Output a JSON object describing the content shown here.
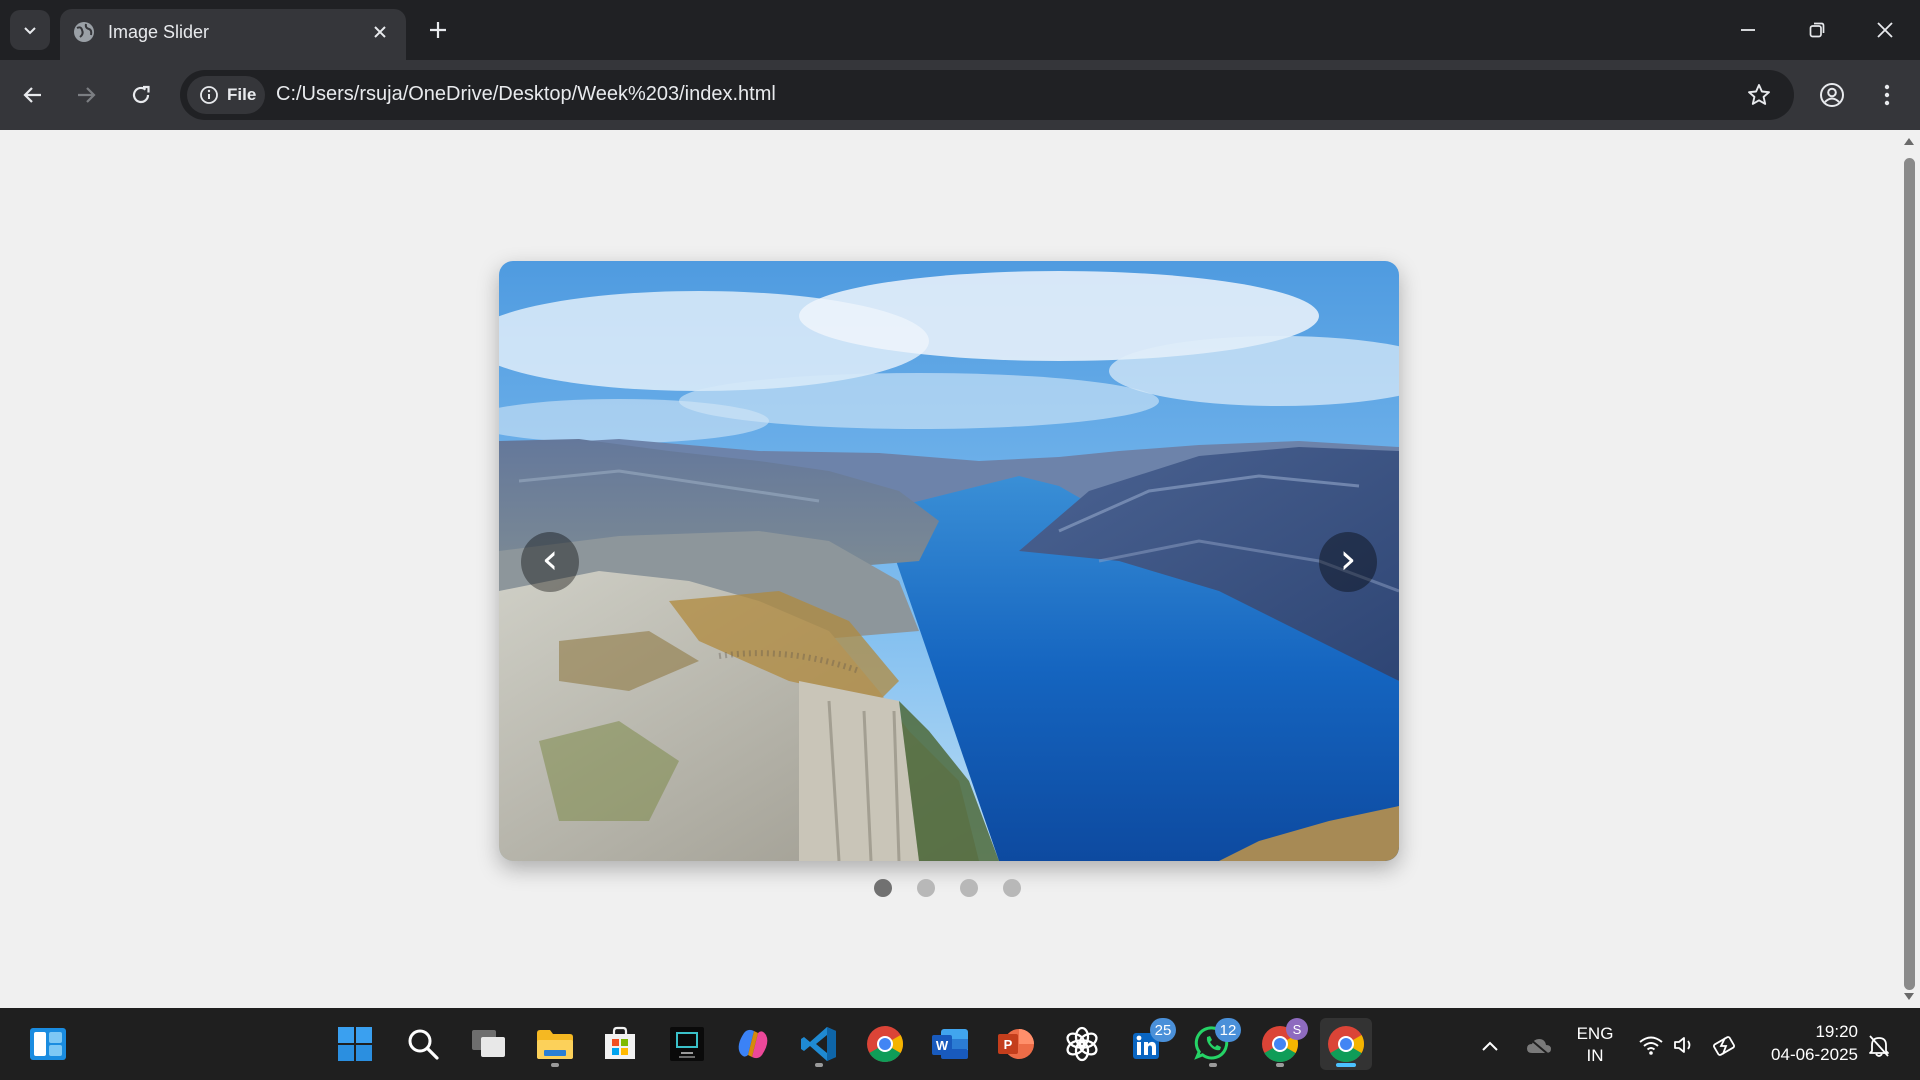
{
  "browser": {
    "tab_title": "Image Slider",
    "site_info_label": "File",
    "url": "C:/Users/rsuja/OneDrive/Desktop/Week%203/index.html",
    "colors": {
      "frame": "#202124",
      "toolbar": "#35363a",
      "text": "#e8eaed"
    }
  },
  "slider": {
    "prev_label": "‹",
    "next_label": "›",
    "image_icon": "fjord-landscape-image",
    "dots_count": 4,
    "active_dot": 1
  },
  "taskbar": {
    "apps": [
      {
        "name": "start",
        "icon": "windows-logo-icon"
      },
      {
        "name": "search",
        "icon": "search-icon"
      },
      {
        "name": "task-view",
        "icon": "task-view-icon"
      },
      {
        "name": "file-explorer",
        "icon": "folder-icon"
      },
      {
        "name": "microsoft-store",
        "icon": "store-icon"
      },
      {
        "name": "screen-recorder",
        "icon": "screen-recorder-icon"
      },
      {
        "name": "copilot",
        "icon": "copilot-icon"
      },
      {
        "name": "vscode",
        "icon": "vscode-icon"
      },
      {
        "name": "chrome",
        "icon": "chrome-icon"
      },
      {
        "name": "word",
        "icon": "word-icon"
      },
      {
        "name": "powerpoint",
        "icon": "powerpoint-icon"
      },
      {
        "name": "chatgpt",
        "icon": "chatgpt-icon"
      },
      {
        "name": "linkedin",
        "icon": "linkedin-icon",
        "badge": "25"
      },
      {
        "name": "whatsapp",
        "icon": "whatsapp-icon",
        "badge": "12"
      },
      {
        "name": "chrome-profile",
        "icon": "chrome-icon",
        "badge": "S"
      },
      {
        "name": "chrome-active",
        "icon": "chrome-icon"
      }
    ],
    "language_line1": "ENG",
    "language_line2": "IN",
    "time": "19:20",
    "date": "04-06-2025"
  }
}
